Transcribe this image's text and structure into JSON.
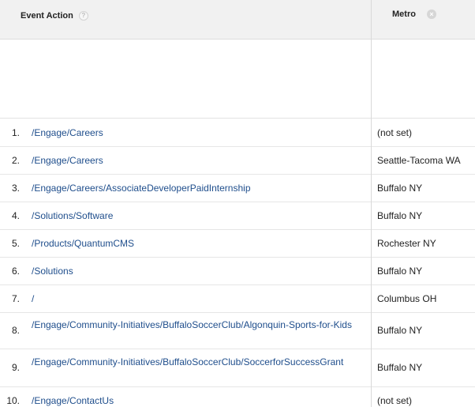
{
  "header": {
    "event_action_label": "Event Action",
    "help_glyph": "?",
    "metro_label": "Metro",
    "close_glyph": "×"
  },
  "rows": [
    {
      "index": "1.",
      "action": "/Engage/Careers",
      "metro": "(not set)"
    },
    {
      "index": "2.",
      "action": "/Engage/Careers",
      "metro": "Seattle-Tacoma WA"
    },
    {
      "index": "3.",
      "action": "/Engage/Careers/AssociateDeveloperPaidInternship",
      "metro": "Buffalo NY"
    },
    {
      "index": "4.",
      "action": "/Solutions/Software",
      "metro": "Buffalo NY"
    },
    {
      "index": "5.",
      "action": "/Products/QuantumCMS",
      "metro": "Rochester NY"
    },
    {
      "index": "6.",
      "action": "/Solutions",
      "metro": "Buffalo NY"
    },
    {
      "index": "7.",
      "action": "/",
      "metro": "Columbus OH"
    },
    {
      "index": "8.",
      "action": "/Engage/Community-Initiatives/BuffaloSoccerClub/Algonquin-Sports-for-Kids",
      "metro": "Buffalo NY"
    },
    {
      "index": "9.",
      "action": "/Engage/Community-Initiatives/BuffaloSoccerClub/SoccerforSuccessGrant",
      "metro": "Buffalo NY"
    },
    {
      "index": "10.",
      "action": "/Engage/ContactUs",
      "metro": "(not set)"
    }
  ],
  "colors": {
    "link": "#1f4e8c",
    "header_bg": "#f1f1f1",
    "grid_line": "#e6e6e6"
  }
}
